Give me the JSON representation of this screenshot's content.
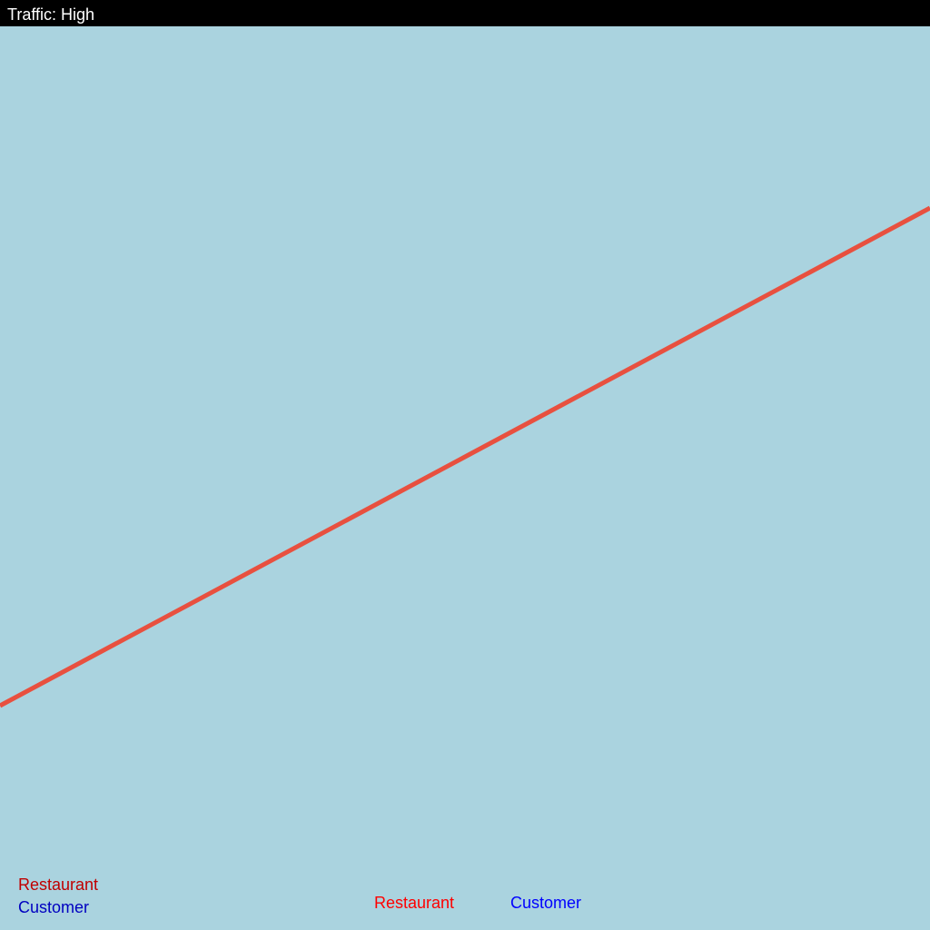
{
  "status": {
    "traffic_text": "Traffic: High"
  },
  "map": {
    "background_color": "#aad3df",
    "route_color": "#e8503f"
  },
  "legend": {
    "restaurant_label": "Restaurant",
    "restaurant_color": "#c00000",
    "customer_label": "Customer",
    "customer_color": "#0000c0"
  },
  "markers": {
    "restaurant_label": "Restaurant",
    "restaurant_color": "#ff0000",
    "customer_label": "Customer",
    "customer_color": "#0000ff"
  }
}
